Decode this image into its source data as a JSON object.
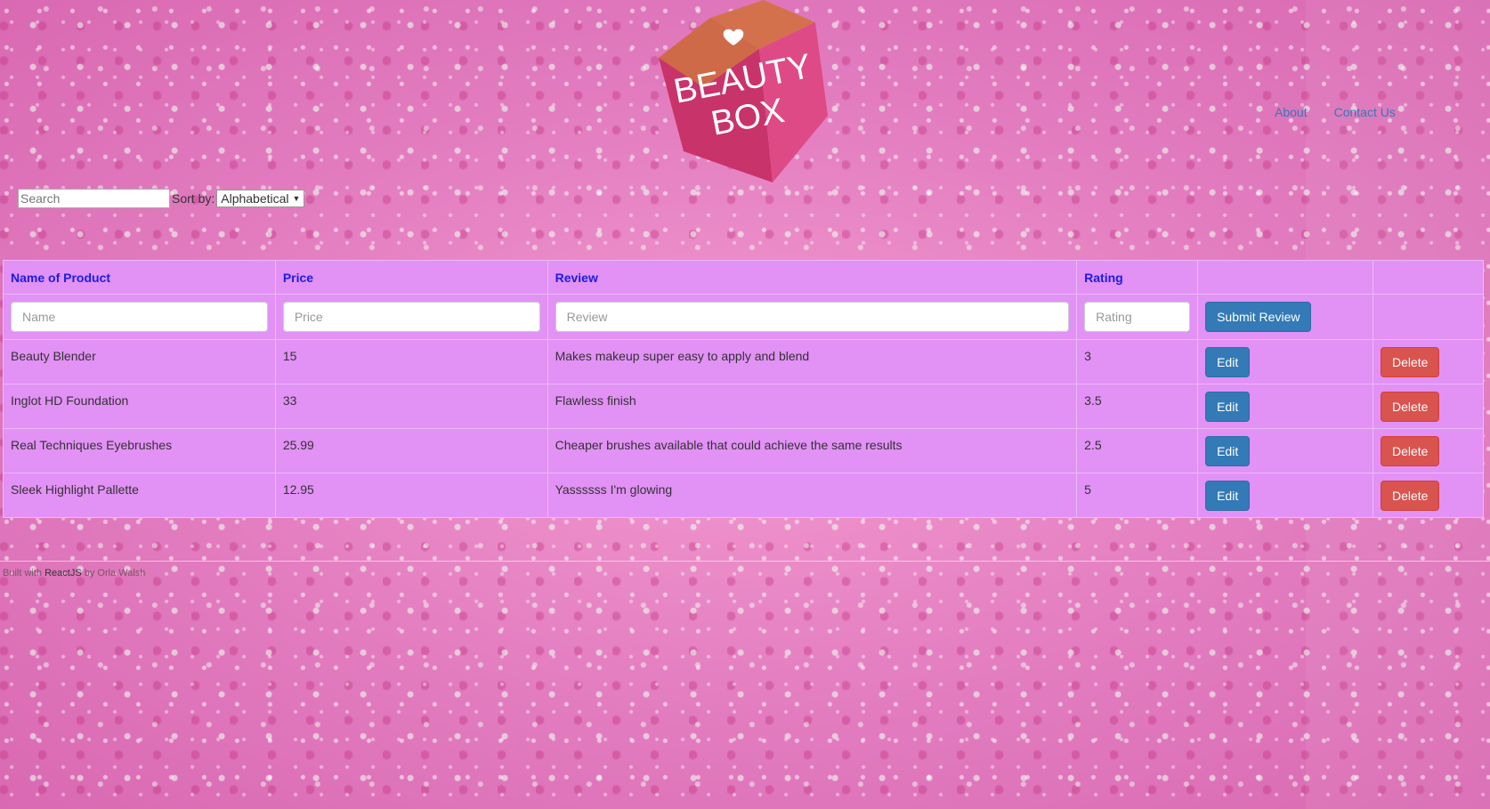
{
  "brand": {
    "logo_text_line1": "BEAUTY",
    "logo_text_line2": "BOX"
  },
  "nav": {
    "items": [
      {
        "label": "About"
      },
      {
        "label": "Contact Us"
      }
    ]
  },
  "toolbar": {
    "search_placeholder": "Search",
    "sort_label": "Sort by:",
    "sort_selected": "Alphabetical"
  },
  "table": {
    "headers": [
      "Name of Product",
      "Price",
      "Review",
      "Rating",
      "",
      ""
    ],
    "form": {
      "name_placeholder": "Name",
      "price_placeholder": "Price",
      "review_placeholder": "Review",
      "rating_placeholder": "Rating",
      "submit_label": "Submit Review"
    },
    "rows": [
      {
        "name": "Beauty Blender",
        "price": "15",
        "review": "Makes makeup super easy to apply and blend",
        "rating": "3",
        "edit_label": "Edit",
        "delete_label": "Delete"
      },
      {
        "name": "Inglot HD Foundation",
        "price": "33",
        "review": "Flawless finish",
        "rating": "3.5",
        "edit_label": "Edit",
        "delete_label": "Delete"
      },
      {
        "name": "Real Techniques Eyebrushes",
        "price": "25.99",
        "review": "Cheaper brushes available that could achieve the same results",
        "rating": "2.5",
        "edit_label": "Edit",
        "delete_label": "Delete"
      },
      {
        "name": "Sleek Highlight Pallette",
        "price": "12.95",
        "review": "Yassssss I'm glowing",
        "rating": "5",
        "edit_label": "Edit",
        "delete_label": "Delete"
      }
    ]
  },
  "footer": {
    "prefix": "Built with ",
    "tech": "ReactJS",
    "suffix": " by Orla Walsh"
  },
  "colors": {
    "accent_primary": "#337ab7",
    "accent_danger": "#d9534f",
    "table_bg": "#e291f5",
    "header_text": "#1c1ce6"
  },
  "icons": {
    "logo": "heart-cube-logo",
    "sort_caret": "caret-down-icon"
  }
}
